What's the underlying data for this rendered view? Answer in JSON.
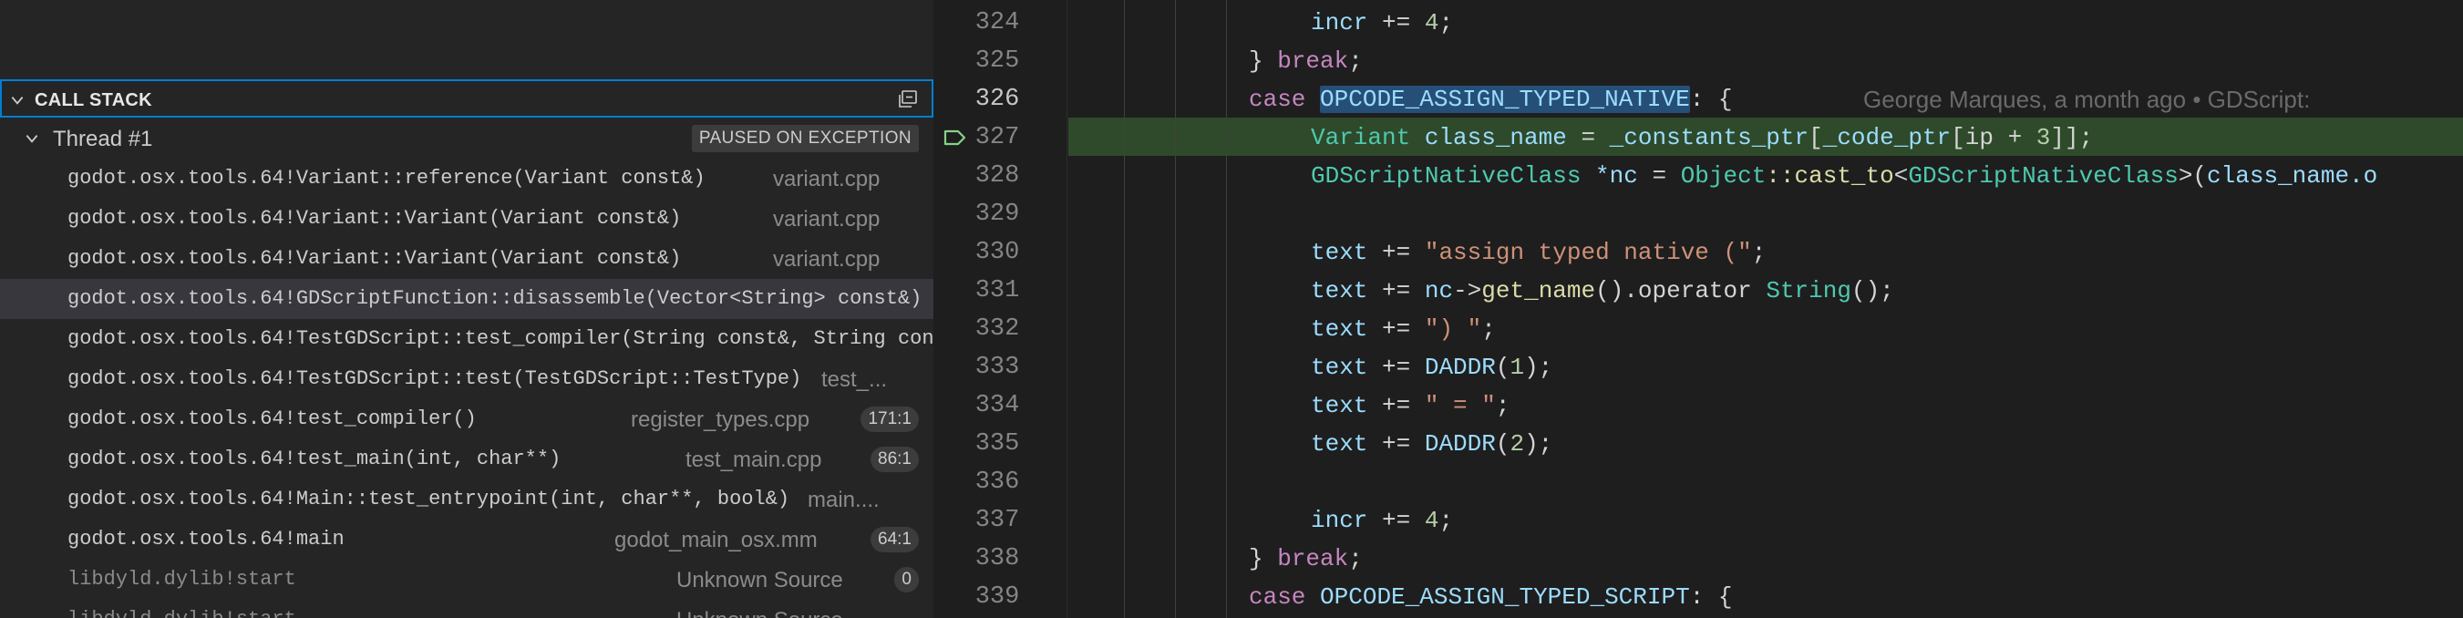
{
  "call_stack": {
    "title": "CALL STACK",
    "thread": {
      "label": "Thread #1",
      "status": "PAUSED ON EXCEPTION"
    },
    "frames": [
      {
        "fn": "godot.osx.tools.64!Variant::reference(Variant const&)",
        "source": "variant.cpp",
        "line": ""
      },
      {
        "fn": "godot.osx.tools.64!Variant::Variant(Variant const&)",
        "source": "variant.cpp",
        "line": ""
      },
      {
        "fn": "godot.osx.tools.64!Variant::Variant(Variant const&)",
        "source": "variant.cpp",
        "line": ""
      },
      {
        "fn": "godot.osx.tools.64!GDScriptFunction::disassemble(Vector<String> const&)",
        "source": "",
        "line": ""
      },
      {
        "fn": "godot.osx.tools.64!TestGDScript::test_compiler(String const&, String con",
        "source": "",
        "line": ""
      },
      {
        "fn": "godot.osx.tools.64!TestGDScript::test(TestGDScript::TestType)",
        "source": "test_...",
        "line": ""
      },
      {
        "fn": "godot.osx.tools.64!test_compiler()",
        "source": "register_types.cpp",
        "line": "171:1"
      },
      {
        "fn": "godot.osx.tools.64!test_main(int, char**)",
        "source": "test_main.cpp",
        "line": "86:1"
      },
      {
        "fn": "godot.osx.tools.64!Main::test_entrypoint(int, char**, bool&)",
        "source": "main....",
        "line": ""
      },
      {
        "fn": "godot.osx.tools.64!main",
        "source": "godot_main_osx.mm",
        "line": "64:1"
      },
      {
        "fn": "libdyld.dylib!start",
        "source": "Unknown Source",
        "line": "0"
      },
      {
        "fn": "libdyld.dylib!start",
        "source": "Unknown Source",
        "line": ""
      }
    ]
  },
  "editor": {
    "line_numbers": [
      "324",
      "325",
      "326",
      "327",
      "328",
      "329",
      "330",
      "331",
      "332",
      "333",
      "334",
      "335",
      "336",
      "337",
      "338",
      "339"
    ],
    "blame": "George Marques, a month ago • GDScript: ",
    "tokens": {
      "incr": "incr",
      "plus_eq": " += ",
      "four": "4",
      "semi": ";",
      "brace_close": "}",
      "brk": " break",
      "case": "case",
      "op_native": "OPCODE_ASSIGN_TYPED_NATIVE",
      "op_script": "OPCODE_ASSIGN_TYPED_SCRIPT",
      "colon_brace": ": {",
      "variant": "Variant",
      "class_name": " class_name",
      "eq": " = ",
      "constants_ptr": "_constants_ptr",
      "lbr": "[",
      "code_ptr": "_code_ptr",
      "ip_plus": "[ip + ",
      "three": "3",
      "close_br": "]];",
      "native_class": "GDScriptNativeClass",
      "star_nc": " *nc",
      "object": "Object",
      "cast_to": "::cast_to",
      "lt": "<",
      "gt_paren": ">(",
      "class_name_o": "class_name.o",
      "text": "text",
      "str_assign": "\"assign typed native (\"",
      "nc": "nc",
      "arrow": "->",
      "get_name": "get_name",
      "operator": "().operator",
      "string_type": " String",
      "parens_semi": "();",
      "str_close": "\") \"",
      "daddr": "DADDR",
      "one": "1",
      "two": "2",
      "paren_open": "(",
      "paren_close_semi": ");",
      "str_eq": "\" = \""
    }
  },
  "colors": {
    "accent": "#007fd4",
    "current_line": "#2e4a2a",
    "breakpoint": "#89d185"
  }
}
